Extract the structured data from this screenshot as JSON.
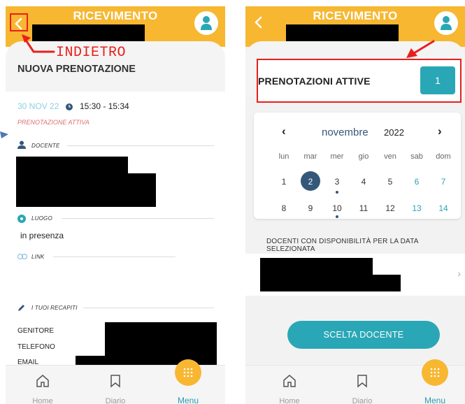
{
  "colors": {
    "header": "#f7b731",
    "accent": "#2aa7b6",
    "selected_day": "#35577a",
    "annotation": "#e8201b"
  },
  "left": {
    "header": {
      "title": "RICEVIMENTO",
      "back_icon": "chevron-left-icon",
      "avatar_icon": "user-icon"
    },
    "annotation": "INDIETRO",
    "section_title": "NUOVA PRENOTAZIONE",
    "booking": {
      "date": "30 NOV 22",
      "time_icon": "clock-icon",
      "time": "15:30 - 15:34",
      "status": "PRENOTAZIONE ATTIVA"
    },
    "docente": {
      "icon": "person-icon",
      "label": "DOCENTE"
    },
    "luogo": {
      "icon": "location-icon",
      "label": "LUOGO",
      "value": "in presenza"
    },
    "link": {
      "icon": "link-icon",
      "label": "LINK"
    },
    "recapiti": {
      "icon": "pencil-icon",
      "label": "I TUOI RECAPITI",
      "rows": [
        "GENITORE",
        "TELEFONO",
        "EMAIL"
      ]
    }
  },
  "right": {
    "header": {
      "title": "RICEVIMENTO",
      "back_icon": "chevron-left-icon",
      "avatar_icon": "user-icon"
    },
    "prenotazioni": {
      "label": "PRENOTAZIONI ATTIVE",
      "count": "1"
    },
    "calendar": {
      "month": "novembre",
      "year": "2022",
      "prev": "‹",
      "next": "›",
      "weekdays": [
        "lun",
        "mar",
        "mer",
        "gio",
        "ven",
        "sab",
        "dom"
      ],
      "week1": [
        "1",
        "2",
        "3",
        "4",
        "5",
        "6",
        "7"
      ],
      "week2": [
        "8",
        "9",
        "10",
        "11",
        "12",
        "13",
        "14"
      ],
      "selected_day": "2",
      "days_with_events": [
        "3",
        "10"
      ]
    },
    "docenti_label": "DOCENTI CON DISPONIBILITÀ PER LA DATA SELEZIONATA",
    "row_chevron": "›",
    "scelta_button": "SCELTA DOCENTE"
  },
  "nav": {
    "items": [
      {
        "label": "Home",
        "icon": "home-icon"
      },
      {
        "label": "Diario",
        "icon": "bookmark-icon"
      },
      {
        "label": "Menu",
        "icon": "menu-grid-icon"
      }
    ]
  }
}
